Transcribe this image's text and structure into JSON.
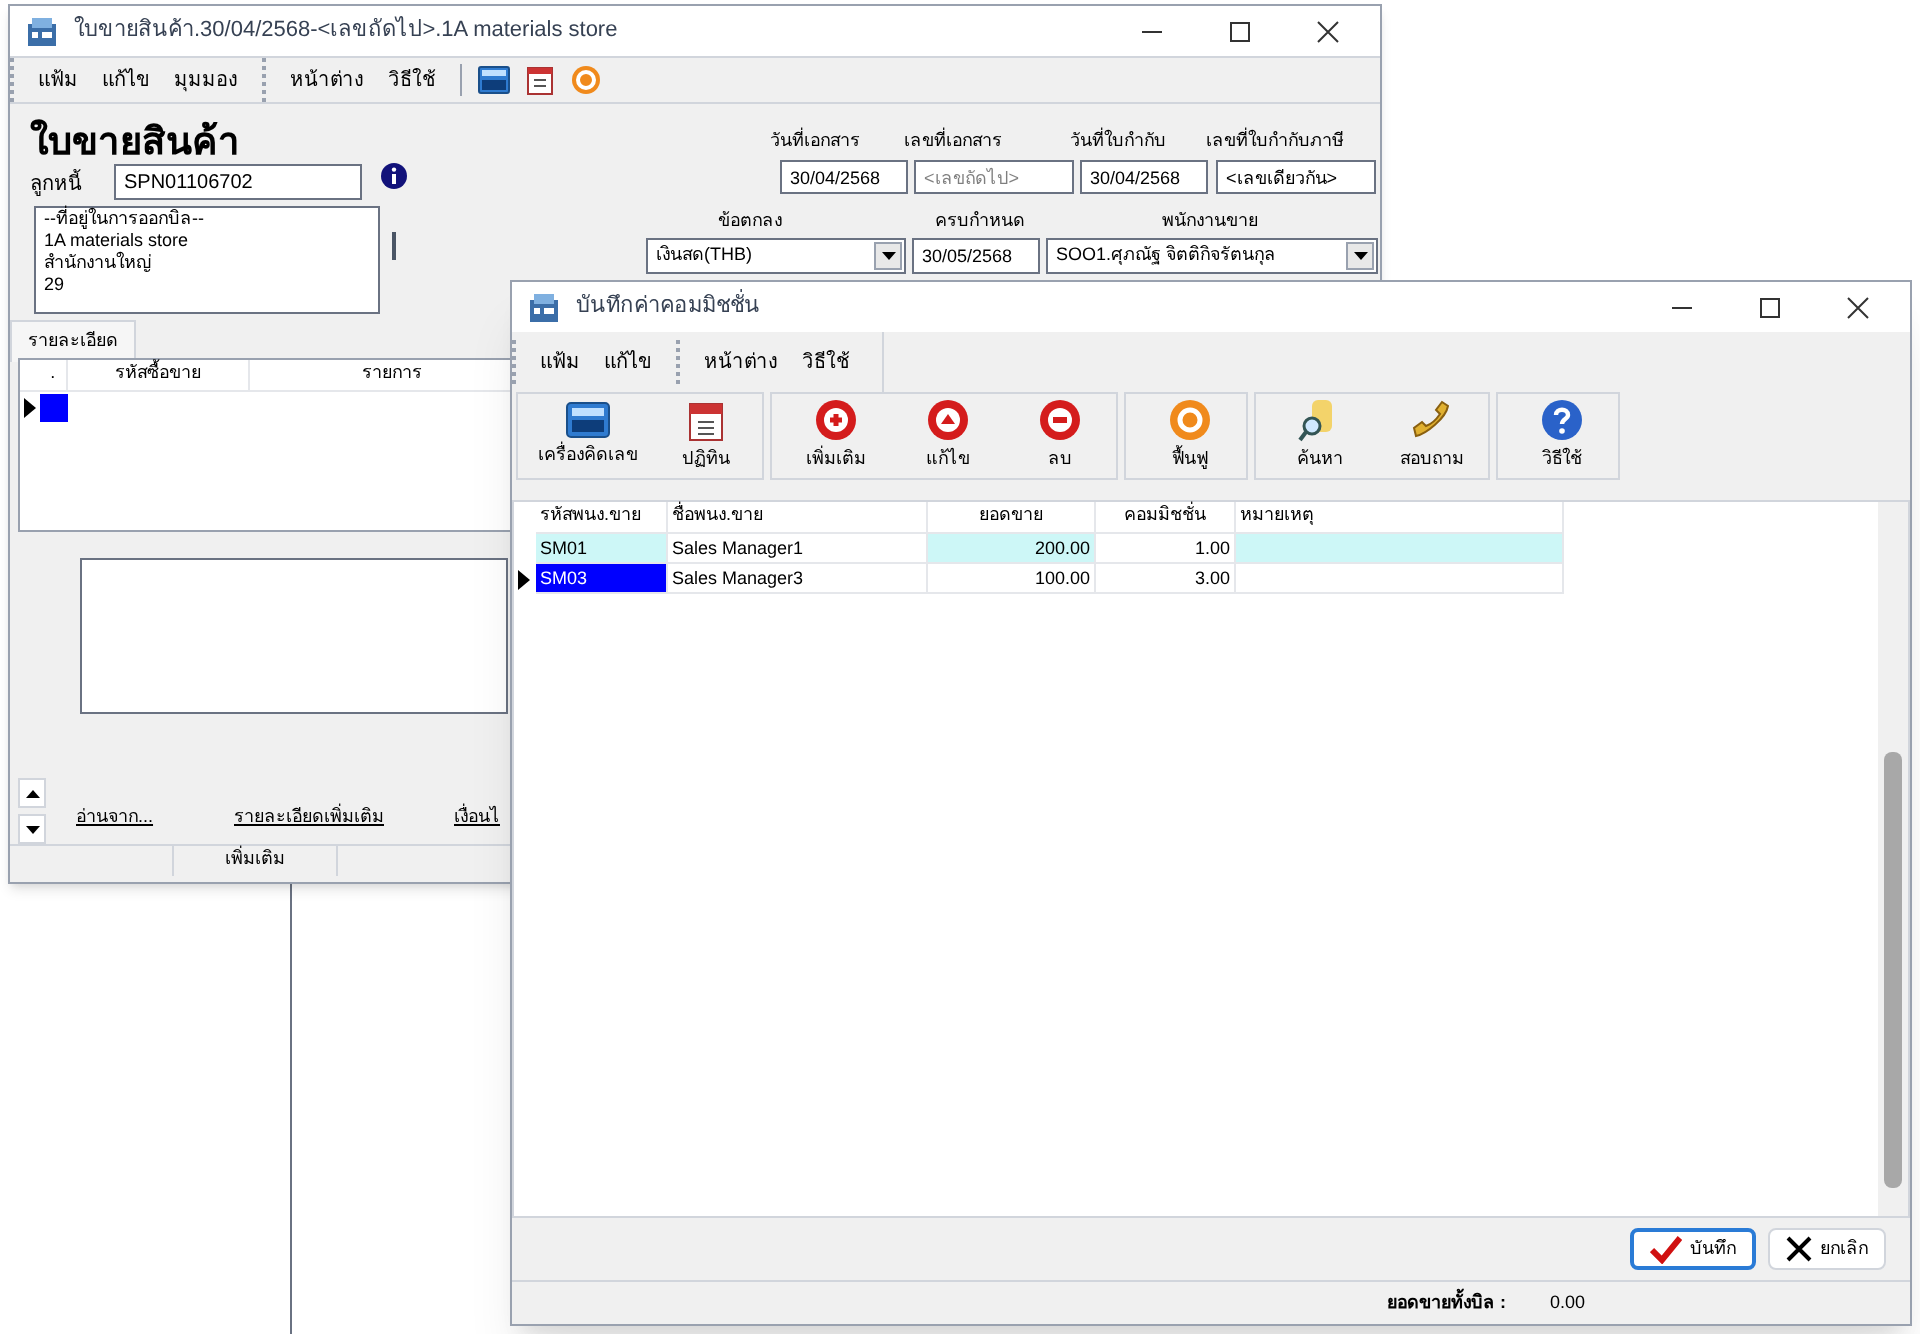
{
  "back_window": {
    "title": "ใบขายสินค้า.30/04/2568-<เลขถัดไป>.1A materials store",
    "menu": [
      [
        "แฟ้ม",
        "แก้ไข",
        "มุมมอง"
      ],
      [
        "หน้าต่าง",
        "วิธีใช้"
      ]
    ],
    "heading": "ใบขายสินค้า",
    "debtor": {
      "label": "ลูกหนี้",
      "value": "SPN01106702"
    },
    "address": [
      "--ที่อยู่ในการออกบิล--",
      "1A materials store",
      "สำนักงานใหญ่",
      "29"
    ],
    "doc_fields": [
      {
        "label": "วันที่เอกสาร",
        "value": "30/04/2568"
      },
      {
        "label": "เลขที่เอกสาร",
        "placeholder": "<เลขถัดไป>"
      },
      {
        "label": "วันที่ใบกำกับ",
        "value": "30/04/2568"
      },
      {
        "label": "เลขที่ใบกำกับภาษี",
        "value": "<เลขเดียวกัน>"
      }
    ],
    "terms": {
      "label": "ข้อตกลง",
      "value": "เงินสด(THB)"
    },
    "due": {
      "label": "ครบกำหนด",
      "value": "30/05/2568"
    },
    "salesman": {
      "label": "พนักงานขาย",
      "value": "SOO1.ศุภณัฐ จิตติกิจรัตนกุล"
    },
    "tabs": [
      {
        "label": "รายละเอียด",
        "selected": true
      }
    ],
    "table": {
      "columns": [
        ".",
        "รหัสซื้อขาย",
        "รายการ"
      ]
    },
    "links": [
      "อ่านจาก...",
      "รายละเอียดเพิ่มเติม",
      "เงื่อนไ"
    ],
    "status_bar": [
      "เพิ่มเติม"
    ]
  },
  "dialog": {
    "title": "บันทึกค่าคอมมิชชั่น",
    "menu": [
      [
        "แฟ้ม",
        "แก้ไข"
      ],
      [
        "หน้าต่าง",
        "วิธีใช้"
      ]
    ],
    "toolbar": [
      [
        {
          "label": "เครื่องคิดเลข",
          "kind": "calculator"
        },
        {
          "label": "ปฏิทิน",
          "kind": "calendar"
        }
      ],
      [
        {
          "label": "เพิ่มเติม",
          "kind": "add"
        },
        {
          "label": "แก้ไข",
          "kind": "edit"
        },
        {
          "label": "ลบ",
          "kind": "delete"
        }
      ],
      [
        {
          "label": "ฟื้นฟู",
          "kind": "refresh"
        }
      ],
      [
        {
          "label": "ค้นหา",
          "kind": "search"
        },
        {
          "label": "สอบถาม",
          "kind": "phone"
        }
      ],
      [
        {
          "label": "วิธีใช้",
          "kind": "help"
        }
      ]
    ],
    "table": {
      "columns": [
        "รหัสพนง.ขาย",
        "ชื่อพนง.ขาย",
        "ยอดขาย",
        "คอมมิชชั่น",
        "หมายเหตุ"
      ],
      "rows": [
        {
          "cells": [
            "SM01",
            "Sales Manager1",
            "200.00",
            "1.00",
            ""
          ],
          "highlighted": true,
          "selected": false
        },
        {
          "cells": [
            "SM03",
            "Sales Manager3",
            "100.00",
            "3.00",
            ""
          ],
          "highlighted": false,
          "selected": true
        }
      ]
    },
    "buttons": [
      {
        "label": "บันทึก",
        "kind": "save"
      },
      {
        "label": "ยกเลิก",
        "kind": "cancel"
      }
    ],
    "status_bar": {
      "label": "ยอดขายทั้งบิล :",
      "value": "0.00"
    }
  }
}
